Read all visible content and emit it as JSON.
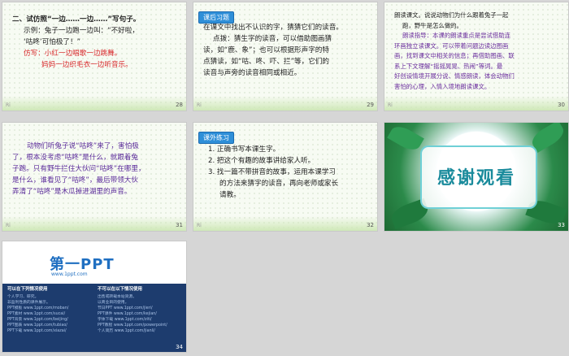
{
  "slides": [
    {
      "page": "28",
      "left_note": "Ri",
      "lines": [
        "二、试仿照“一边……一边……”写句子。",
        "示例：兔子一边跑一边叫：“不好啦，",
        "‘咕咚’可怕极了！”",
        "仿写：小红一边唱歌一边跳舞。",
        "妈妈一边织毛衣一边听音乐。"
      ]
    },
    {
      "page": "29",
      "left_note": "Ri",
      "tag": "课后习题",
      "lines": [
        "在课文中找出不认识的字，猜猜它们的读音。",
        "点拨：猜生字的读音，可以借助图画猜",
        "读，如“鹿、象”；也可以根据形声字的特",
        "点猜读，如“咕、咚、吓、拦”等，它们的",
        "读音与声旁的读音相同或相近。"
      ]
    },
    {
      "page": "30",
      "left_note": "Ri",
      "lines": [
        "朗读课文。说说动物们为什么跟着兔子一起",
        "跑，野牛是怎么做的。",
        "朗读指导：本课的朗读重点是尝试借助连",
        "环画独立读课文。可以带着问题边读边图画",
        "画，找到课文中相关的信息；再借助图画、联",
        "系上下文理解“摇摇晃晃、热闹”等词。最",
        "好创设情境开展分说、情感朗读，体会动物们",
        "害怕的心理，入情入境地朗读课文。"
      ]
    },
    {
      "page": "31",
      "left_note": "Ri",
      "lines": [
        "动物们听兔子说“咕咚”来了，害怕极",
        "了，根本没考虑“咕咚”是什么，就跟着兔",
        "子跑。只有野牛拦住大伙问“咕咚”在哪里，",
        "是什么，谁看见了“咕咚”，最后带领大伙",
        "弄清了“咕咚”是木瓜掉进湖里的声音。"
      ]
    },
    {
      "page": "32",
      "left_note": "Ri",
      "tag": "课外练习",
      "lines": [
        "1. 正确书写本课生字。",
        "2. 把这个有趣的故事讲给家人听。",
        "3. 找一篇不带拼音的故事，运用本课学习",
        "的方法来猜字的读音，再向老师或家长",
        "请教。"
      ]
    }
  ],
  "thanks": {
    "page": "33",
    "title": "感谢观看"
  },
  "promo": {
    "page": "34",
    "logo": "第一PPT",
    "url": "www.1ppt.com",
    "col1_head": "可以在下列情况使用",
    "col2_head": "不可以在以下情况使用",
    "col1_lines": [
      "个人学习、研究。",
      "非盈利性质的课件展示。",
      "PPT模板 www.1ppt.com/moban/",
      "PPT素材 www.1ppt.com/sucai/",
      "PPT背景 www.1ppt.com/beijing/",
      "PPT图表 www.1ppt.com/tubiao/",
      "PPT下载 www.1ppt.com/xiazai/"
    ],
    "col2_lines": [
      "出售或转载本站资源。",
      "以商业目的使用。",
      "节日PPT www.1ppt.com/jieri/",
      "PPT课件 www.1ppt.com/kejian/",
      "字体下载 www.1ppt.com/ziti/",
      "PPT教程 www.1ppt.com/powerpoint/",
      "个人简历 www.1ppt.com/jianli/"
    ]
  }
}
